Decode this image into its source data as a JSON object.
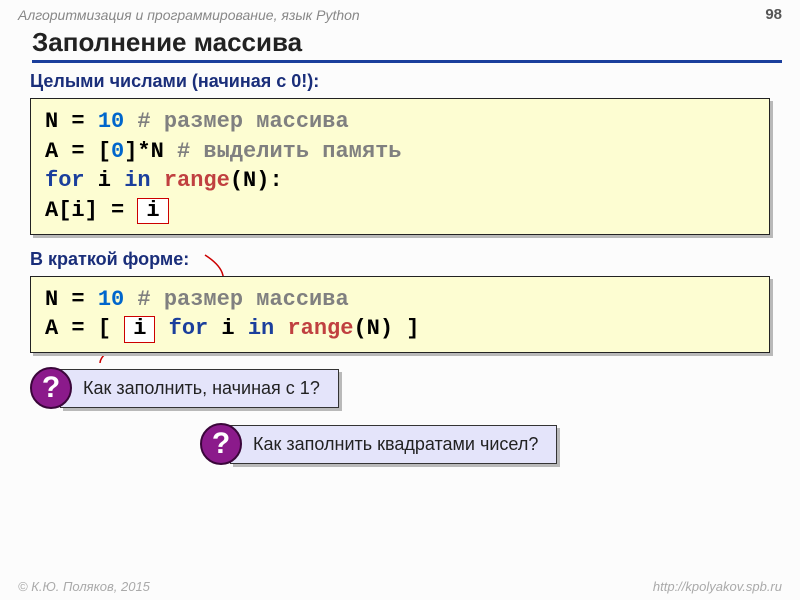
{
  "header": {
    "course": "Алгоритмизация и программирование, язык Python",
    "pageNumber": "98"
  },
  "title": "Заполнение массива",
  "block1": {
    "caption": "Целыми числами (начиная с 0!):",
    "line1_a": "N = ",
    "line1_num": "10",
    "line1_cm": "      # размер массива",
    "line2_a": "A = [",
    "line2_num": "0",
    "line2_b": "]*N  ",
    "line2_cm": "# выделить память",
    "line3_for": "for",
    "line3_mid": " i ",
    "line3_in": "in",
    "line3_sp": " ",
    "line3_range": "range",
    "line3_end": "(N):",
    "line4_a": "   A[i] = ",
    "line4_box": "i"
  },
  "block2": {
    "caption": "В краткой форме:",
    "line1_a": "N = ",
    "line1_num": "10",
    "line1_cm": "      # размер массива",
    "line2_a": "A = [ ",
    "line2_box": "i",
    "line2_sp": " ",
    "line2_for": "for",
    "line2_mid": " i ",
    "line2_in": "in",
    "line2_sp2": " ",
    "line2_range": "range",
    "line2_end": "(N) ]"
  },
  "questions": {
    "mark": "?",
    "q1": " Как заполнить, начиная с 1?",
    "q2": " Как заполнить квадратами чисел?"
  },
  "footer": {
    "left": "© К.Ю. Поляков, 2015",
    "right": "http://kpolyakov.spb.ru"
  }
}
